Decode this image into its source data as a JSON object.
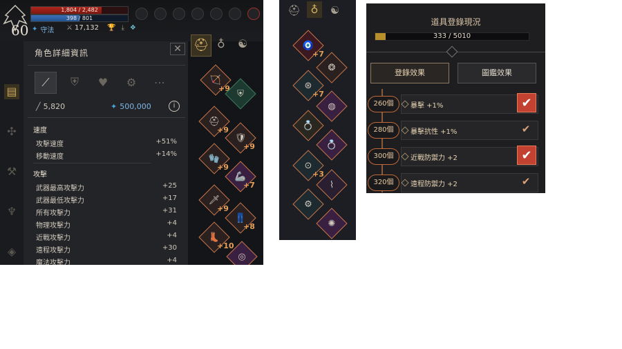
{
  "panel1": {
    "hp": {
      "text": "1,804 / 2,482",
      "fill_fraction": 0.727
    },
    "mp": {
      "text": "398 / 801",
      "fill_fraction": 0.497
    },
    "level": "60",
    "guard_label": "守法",
    "kill_count": "17,132",
    "sheet_title": "角色詳細資訊",
    "attack_value": "5,820",
    "combat_power": "500,000",
    "speed_section": "速度",
    "speed_stats": [
      {
        "label": "攻擊速度",
        "value": "+51%"
      },
      {
        "label": "移動速度",
        "value": "+14%"
      }
    ],
    "attack_section": "攻擊",
    "attack_stats": [
      {
        "label": "武器最高攻擊力",
        "value": "+25"
      },
      {
        "label": "武器最低攻擊力",
        "value": "+17"
      },
      {
        "label": "所有攻擊力",
        "value": "+31"
      },
      {
        "label": "物理攻擊力",
        "value": "+4"
      },
      {
        "label": "近戰攻擊力",
        "value": "+4"
      },
      {
        "label": "遠程攻擊力",
        "value": "+30"
      },
      {
        "label": "魔法攻擊力",
        "value": "+4"
      }
    ],
    "gear_plus": [
      "+9",
      "+9",
      "+9",
      "+9",
      "+7",
      "+9",
      "+8",
      "+10"
    ]
  },
  "panel2": {
    "gear_plus": [
      "+7",
      "+7",
      "+3"
    ]
  },
  "panel3": {
    "title": "道具登錄現況",
    "progress": {
      "text": "333 / 5010",
      "fill_fraction": 0.0665
    },
    "tab_register": "登錄效果",
    "tab_codex": "圖鑑效果",
    "rows": [
      {
        "count": "260個",
        "effect": "暴擊 +1%",
        "checked": true
      },
      {
        "count": "280個",
        "effect": "暴擊抗性 +1%",
        "checked": false
      },
      {
        "count": "300個",
        "effect": "近戰防禦力 +2",
        "checked": true
      },
      {
        "count": "320個",
        "effect": "遠程防禦力 +2",
        "checked": false
      }
    ]
  },
  "colors": {
    "accent": "#c06a3a",
    "hp": "#b0261c",
    "mp": "#3b6fb8",
    "check_on": "#c34130",
    "gold": "#b8902b"
  }
}
